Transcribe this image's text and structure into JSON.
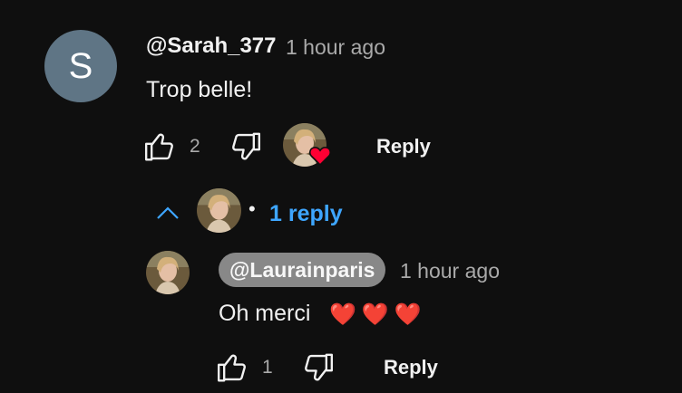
{
  "comment": {
    "avatar_letter": "S",
    "author": "@Sarah_377",
    "time": "1 hour ago",
    "text": "Trop belle!",
    "like_count": "2",
    "reply_label": "Reply",
    "heart_color": "#ff0033"
  },
  "replies_toggle": {
    "separator": "•",
    "label": "1 reply",
    "color": "#3ea6ff"
  },
  "reply": {
    "author": "@Laurainparis",
    "time": "1 hour ago",
    "text": "Oh merci",
    "hearts": [
      "❤️",
      "❤️",
      "❤️"
    ],
    "like_count": "1",
    "reply_label": "Reply"
  },
  "icons": [
    "thumb-up-icon",
    "thumb-down-icon",
    "chevron-up-icon",
    "heart-icon"
  ]
}
